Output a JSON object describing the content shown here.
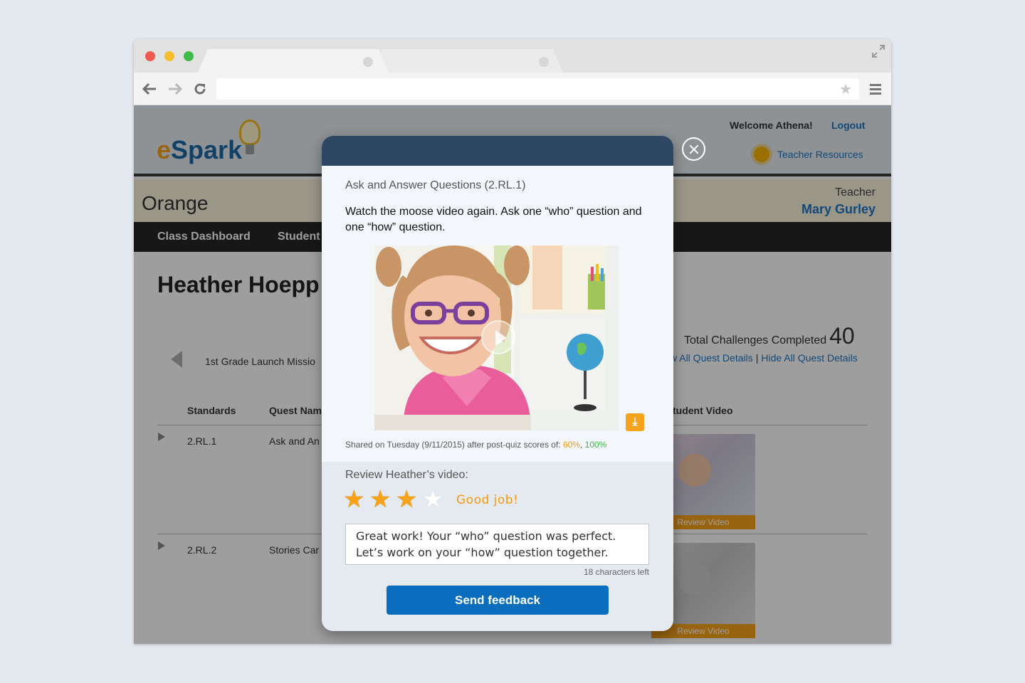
{
  "browser": {
    "colors": {
      "close": "#ed594f",
      "minimize": "#f6be2f",
      "maximize": "#3fbb4b"
    },
    "back_icon": "arrow-left-icon",
    "forward_icon": "arrow-right-icon",
    "reload_icon": "reload-icon",
    "url": ""
  },
  "app": {
    "logo": {
      "e": "e",
      "spark": "Spark"
    },
    "welcome": "Welcome Athena!",
    "logout": "Logout",
    "teacher_resources": "Teacher Resources",
    "class_name": "Orange",
    "teacher_label": "Teacher",
    "teacher_name": "Mary Gurley",
    "nav": [
      "Class Dashboard",
      "Student"
    ],
    "student_name": "Heather Hoepp",
    "total_label": "Total Challenges Completed",
    "total_value": "40",
    "show_all": "w All Quest Details",
    "link_sep": "|",
    "hide_all": "Hide All Quest Details",
    "mission": "1st Grade Launch Missio",
    "table_headers": {
      "standards": "Standards",
      "quest": "Quest Nam",
      "video": "tudent Video"
    },
    "rows": [
      {
        "standard": "2.RL.1",
        "quest": "Ask and An",
        "thumb_label": "Review Video"
      },
      {
        "standard": "2.RL.2",
        "quest": "Stories Car",
        "thumb_label": "Review Video"
      }
    ]
  },
  "modal": {
    "title": "Ask and Answer Questions (2.RL.1)",
    "prompt": "Watch the moose video again. Ask one “who” question and one “how” question.",
    "shared_prefix": "Shared on Tuesday (9/11/2015) after post-quiz scores of: ",
    "score1": "60%",
    "score_sep": ", ",
    "score2": "100%",
    "review_label": "Review Heather’s video:",
    "rating": 3,
    "rating_max": 4,
    "rating_text": "Good job!",
    "feedback": "Great work! Your “who” question was perfect. Let’s work on your “how” question together.",
    "chars_left": "18 characters left",
    "send_label": "Send feedback"
  }
}
